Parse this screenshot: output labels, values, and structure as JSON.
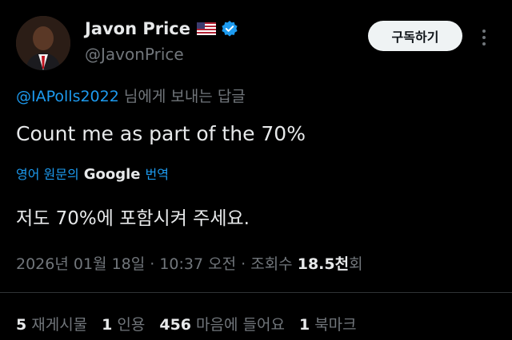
{
  "author": {
    "name": "Javon Price",
    "handle": "@JavonPrice",
    "flag_icon": "us-flag-icon",
    "verified_icon": "verified-badge-icon"
  },
  "follow_label": "구독하기",
  "reply_to": {
    "mention": "@IAPolls2022",
    "suffix": " 님에게 보내는 답글"
  },
  "text": "Count me as part of the 70%",
  "translation": {
    "prefix": "영어 원문의",
    "provider": "Google",
    "suffix": "번역",
    "text": "저도 70%에 포함시켜 주세요."
  },
  "meta": {
    "date": "2026년 01월 18일 · 10:37 오전 · 조회수",
    "views": "18.5천",
    "views_suffix": "회"
  },
  "stats": [
    {
      "count": "5",
      "label": "재게시물"
    },
    {
      "count": "1",
      "label": "인용"
    },
    {
      "count": "456",
      "label": "마음에 들어요"
    },
    {
      "count": "1",
      "label": "북마크"
    }
  ],
  "colors": {
    "accent": "#1d9bf0",
    "background": "#000000",
    "text": "#e7e9ea",
    "muted": "#71767b"
  }
}
